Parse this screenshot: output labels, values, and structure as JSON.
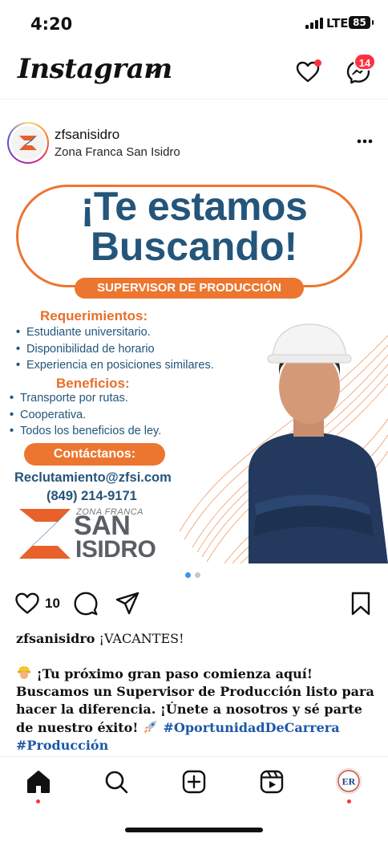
{
  "status_bar": {
    "time": "4:20",
    "network": "LTE",
    "battery": "85"
  },
  "header": {
    "app_name": "Instagram",
    "notification_badge": "14",
    "icons": [
      "chevron-down-icon",
      "heart-icon",
      "messenger-icon"
    ],
    "accent_color": "#ff3040"
  },
  "post": {
    "username": "zfsanisidro",
    "subtitle": "Zona Franca San Isidro",
    "image": {
      "headline_line1": "¡Te estamos",
      "headline_line2": "Buscando!",
      "position": "SUPERVISOR DE PRODUCCIÓN",
      "requirements_title": "Requerimientos:",
      "requirements": [
        "Estudiante universitario.",
        "Disponibilidad de horario",
        "Experiencia en posiciones similares."
      ],
      "benefits_title": "Beneficios:",
      "benefits": [
        "Transporte por rutas.",
        "Cooperativa.",
        "Todos los beneficios de ley."
      ],
      "contact_title": "Contáctanos:",
      "email": "Reclutamiento@zfsi.com",
      "phone": "(849) 214-9171",
      "brand_top": "ZONA FRANCA",
      "brand_line1": "SAN",
      "brand_line2": "ISIDRO",
      "colors": {
        "blue": "#24557a",
        "orange": "#ec7630"
      }
    },
    "carousel": {
      "current": 1,
      "total": 2
    },
    "likes": "10",
    "caption_user": "zfsanisidro",
    "caption_title": "¡VACANTES!",
    "caption_text": "¡Tu próximo gran paso comienza aquí! Buscamos un Supervisor de Producción listo para hacer la diferencia. ¡Únete a nosotros y sé parte de nuestro éxito!",
    "hashtags": [
      "#OportunidadDeCarrera",
      "#Producción"
    ]
  },
  "bottom_nav": {
    "items": [
      "home-icon",
      "search-icon",
      "create-icon",
      "reels-icon",
      "profile-avatar"
    ],
    "profile_initials": "ER"
  }
}
